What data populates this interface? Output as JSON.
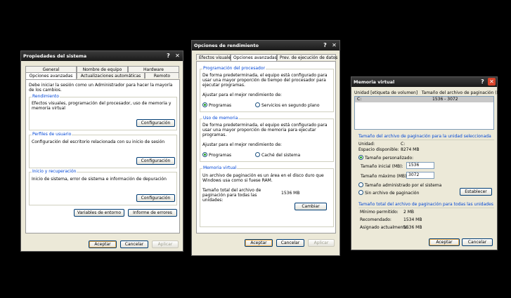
{
  "w1": {
    "title": "Propiedades del sistema",
    "tabs_row1": [
      "General",
      "Nombre de equipo",
      "Hardware"
    ],
    "tabs_row2": [
      "Opciones avanzadas",
      "Actualizaciones automáticas",
      "Remoto"
    ],
    "intro": "Debe iniciar la sesión como un Administrador para hacer la mayoría de los cambios.",
    "g1": {
      "title": "Rendimiento",
      "text": "Efectos visuales, programación del procesador, uso de memoria y memoria virtual",
      "btn": "Configuración"
    },
    "g2": {
      "title": "Perfiles de usuario",
      "text": "Configuración del escritorio relacionada con su inicio de sesión",
      "btn": "Configuración"
    },
    "g3": {
      "title": "Inicio y recuperación",
      "text": "Inicio de sistema, error de sistema e información de depuración",
      "btn": "Configuración"
    },
    "env_btn": "Variables de entorno",
    "err_btn": "Informe de errores",
    "ok": "Aceptar",
    "cancel": "Cancelar",
    "apply": "Aplicar"
  },
  "w2": {
    "title": "Opciones de rendimiento",
    "tabs": [
      "Efectos visuales",
      "Opciones avanzadas",
      "Prev. de ejecución de datos"
    ],
    "g1": {
      "title": "Programación del procesador",
      "text": "De forma predeterminada, el equipo está configurado para usar una mayor proporción de tiempo del procesador para ejecutar programas.",
      "adjust": "Ajustar para el mejor rendimiento de:",
      "opt1": "Programas",
      "opt2": "Servicios en segundo plano"
    },
    "g2": {
      "title": "Uso de memoria",
      "text": "De forma predeterminada, el equipo está configurado para usar una mayor proporción de memoria para ejecutar programas.",
      "adjust": "Ajustar para el mejor rendimiento de:",
      "opt1": "Programas",
      "opt2": "Caché del sistema"
    },
    "g3": {
      "title": "Memoria virtual",
      "text": "Un archivo de paginación es un área en el disco duro que Windows usa como si fuese RAM.",
      "total_label": "Tamaño total del archivo de paginación para todas las unidades:",
      "total_value": "1536 MB",
      "btn": "Cambiar"
    },
    "ok": "Aceptar",
    "cancel": "Cancelar",
    "apply": "Aplicar"
  },
  "w3": {
    "title": "Memoria virtual",
    "header": "Unidad [etiqueta de volumen]   Tamaño del archivo de paginación (MB)",
    "row_drive": "C:",
    "row_size": "1536 - 3072",
    "sel_title": "Tamaño del archivo de paginación para la unidad seleccionada",
    "unit_label": "Unidad:",
    "unit_val": "C:",
    "space_label": "Espacio disponible:",
    "space_val": "8274 MB",
    "custom": "Tamaño personalizado:",
    "init_label": "Tamaño inicial (MB):",
    "init_val": "1536",
    "max_label": "Tamaño máximo (MB):",
    "max_val": "3072",
    "managed": "Tamaño administrado por el sistema",
    "none": "Sin archivo de paginación",
    "set_btn": "Establecer",
    "total_title": "Tamaño total del archivo de paginación para todas las unidades",
    "min_label": "Mínimo permitido:",
    "min_val": "2 MB",
    "rec_label": "Recomendado:",
    "rec_val": "1534 MB",
    "cur_label": "Asignado actualmente:",
    "cur_val": "1536 MB",
    "ok": "Aceptar",
    "cancel": "Cancelar"
  }
}
